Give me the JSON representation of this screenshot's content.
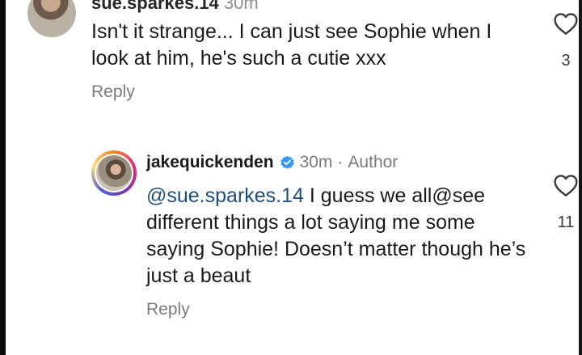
{
  "comment1": {
    "username": "sue.sparkes.14",
    "time": "30m",
    "text": "Isn't it strange... I can just see Sophie when I look at him, he's such a cutie xxx",
    "reply_label": "Reply",
    "likes": "3"
  },
  "comment2": {
    "username": "jakequickenden",
    "time": "30m",
    "separator": "·",
    "role": "Author",
    "mention": "@sue.sparkes.14",
    "text": " I guess we all@see different things a lot saying me some saying Sophie! Doesn’t matter though he’s just a beaut",
    "reply_label": "Reply",
    "likes": "11"
  },
  "icons": {
    "like": "heart-outline-icon",
    "verified": "verified-badge-icon"
  },
  "colors": {
    "text": "#1a1a1a",
    "secondary": "#7b7b7b",
    "mention": "#1f4e79",
    "verified": "#3897f0"
  }
}
